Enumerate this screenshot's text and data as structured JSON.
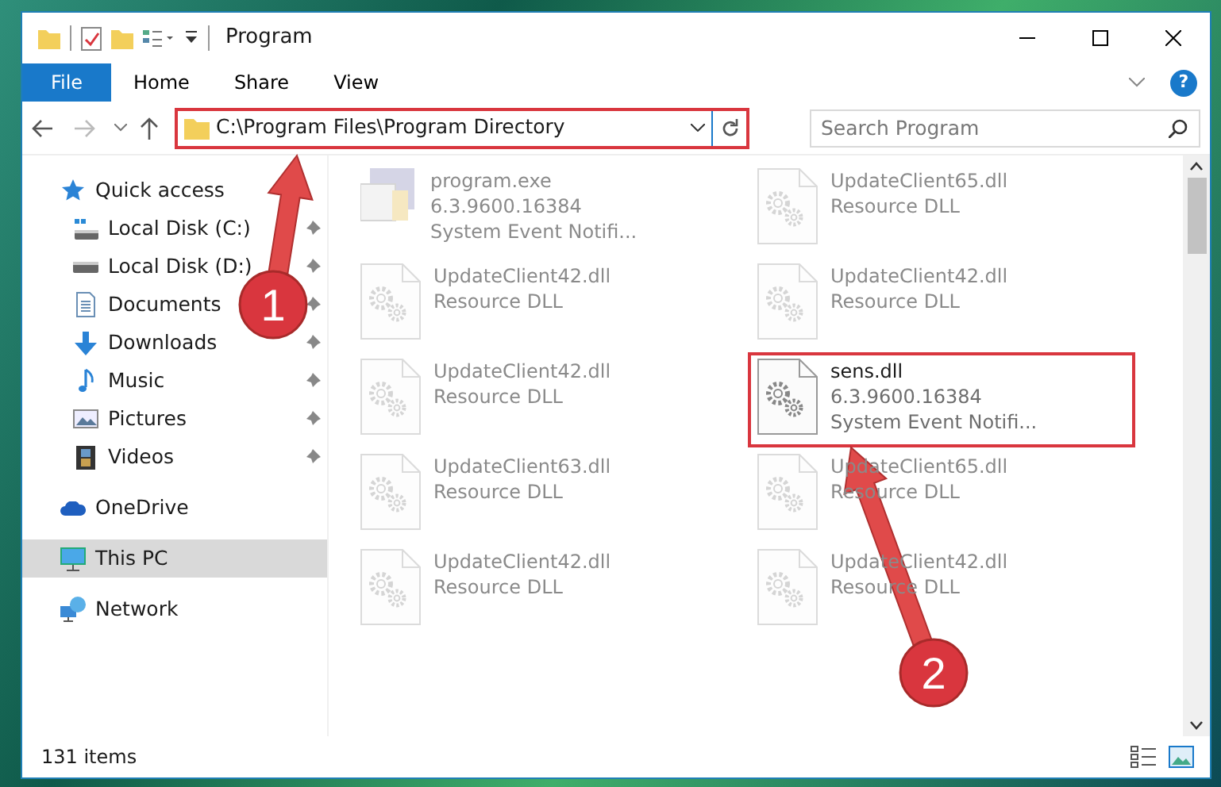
{
  "window": {
    "title": "Program"
  },
  "ribbon": {
    "tabs": [
      {
        "label": "File",
        "kind": "file"
      },
      {
        "label": "Home",
        "kind": "tab"
      },
      {
        "label": "Share",
        "kind": "tab"
      },
      {
        "label": "View",
        "kind": "tab"
      }
    ],
    "help": "?"
  },
  "address_bar": {
    "path": "C:\\Program Files\\Program Directory",
    "highlighted": true
  },
  "search": {
    "placeholder": "Search Program"
  },
  "sidebar": {
    "items": [
      {
        "label": "Quick access",
        "kind": "star",
        "selected": false,
        "children": [
          {
            "label": "Local Disk (C:)",
            "kind": "drive-c",
            "pinned": true,
            "selected": false
          },
          {
            "label": "Local Disk (D:)",
            "kind": "drive",
            "pinned": true,
            "selected": false
          },
          {
            "label": "Documents",
            "kind": "documents",
            "pinned": true,
            "selected": false
          },
          {
            "label": "Downloads",
            "kind": "downloads",
            "pinned": true,
            "selected": false
          },
          {
            "label": "Music",
            "kind": "music",
            "pinned": true,
            "selected": false
          },
          {
            "label": "Pictures",
            "kind": "pictures",
            "pinned": true,
            "selected": false
          },
          {
            "label": "Videos",
            "kind": "videos",
            "pinned": true,
            "selected": false
          }
        ]
      },
      {
        "label": "OneDrive",
        "kind": "cloud",
        "selected": false
      },
      {
        "label": "This PC",
        "kind": "pc",
        "selected": true
      },
      {
        "label": "Network",
        "kind": "network",
        "selected": false
      }
    ]
  },
  "files": [
    {
      "name": "program.exe",
      "details": [
        "6.3.9600.16384",
        "System Event Notifi..."
      ],
      "kind": "app",
      "faded": true,
      "highlighted": false
    },
    {
      "name": "UpdateClient65.dll",
      "details": [
        "Resource DLL"
      ],
      "kind": "dll",
      "faded": true,
      "highlighted": false
    },
    {
      "name": "UpdateClient42.dll",
      "details": [
        "Resource DLL"
      ],
      "kind": "dll",
      "faded": true,
      "highlighted": false
    },
    {
      "name": "UpdateClient42.dll",
      "details": [
        "Resource DLL"
      ],
      "kind": "dll",
      "faded": true,
      "highlighted": false
    },
    {
      "name": "UpdateClient42.dll",
      "details": [
        "Resource DLL"
      ],
      "kind": "dll",
      "faded": true,
      "highlighted": false
    },
    {
      "name": "sens.dll",
      "details": [
        "6.3.9600.16384",
        "System Event Notifi..."
      ],
      "kind": "dll",
      "faded": false,
      "highlighted": true
    },
    {
      "name": "UpdateClient63.dll",
      "details": [
        "Resource DLL"
      ],
      "kind": "dll",
      "faded": true,
      "highlighted": false
    },
    {
      "name": "UpdateClient65.dll",
      "details": [
        "Resource DLL"
      ],
      "kind": "dll",
      "faded": true,
      "highlighted": false
    },
    {
      "name": "UpdateClient42.dll",
      "details": [
        "Resource DLL"
      ],
      "kind": "dll",
      "faded": true,
      "highlighted": false
    },
    {
      "name": "UpdateClient42.dll",
      "details": [
        "Resource DLL"
      ],
      "kind": "dll",
      "faded": true,
      "highlighted": false
    }
  ],
  "status_bar": {
    "count": "131 items"
  },
  "annotations": [
    {
      "number": "1"
    },
    {
      "number": "2"
    }
  ]
}
